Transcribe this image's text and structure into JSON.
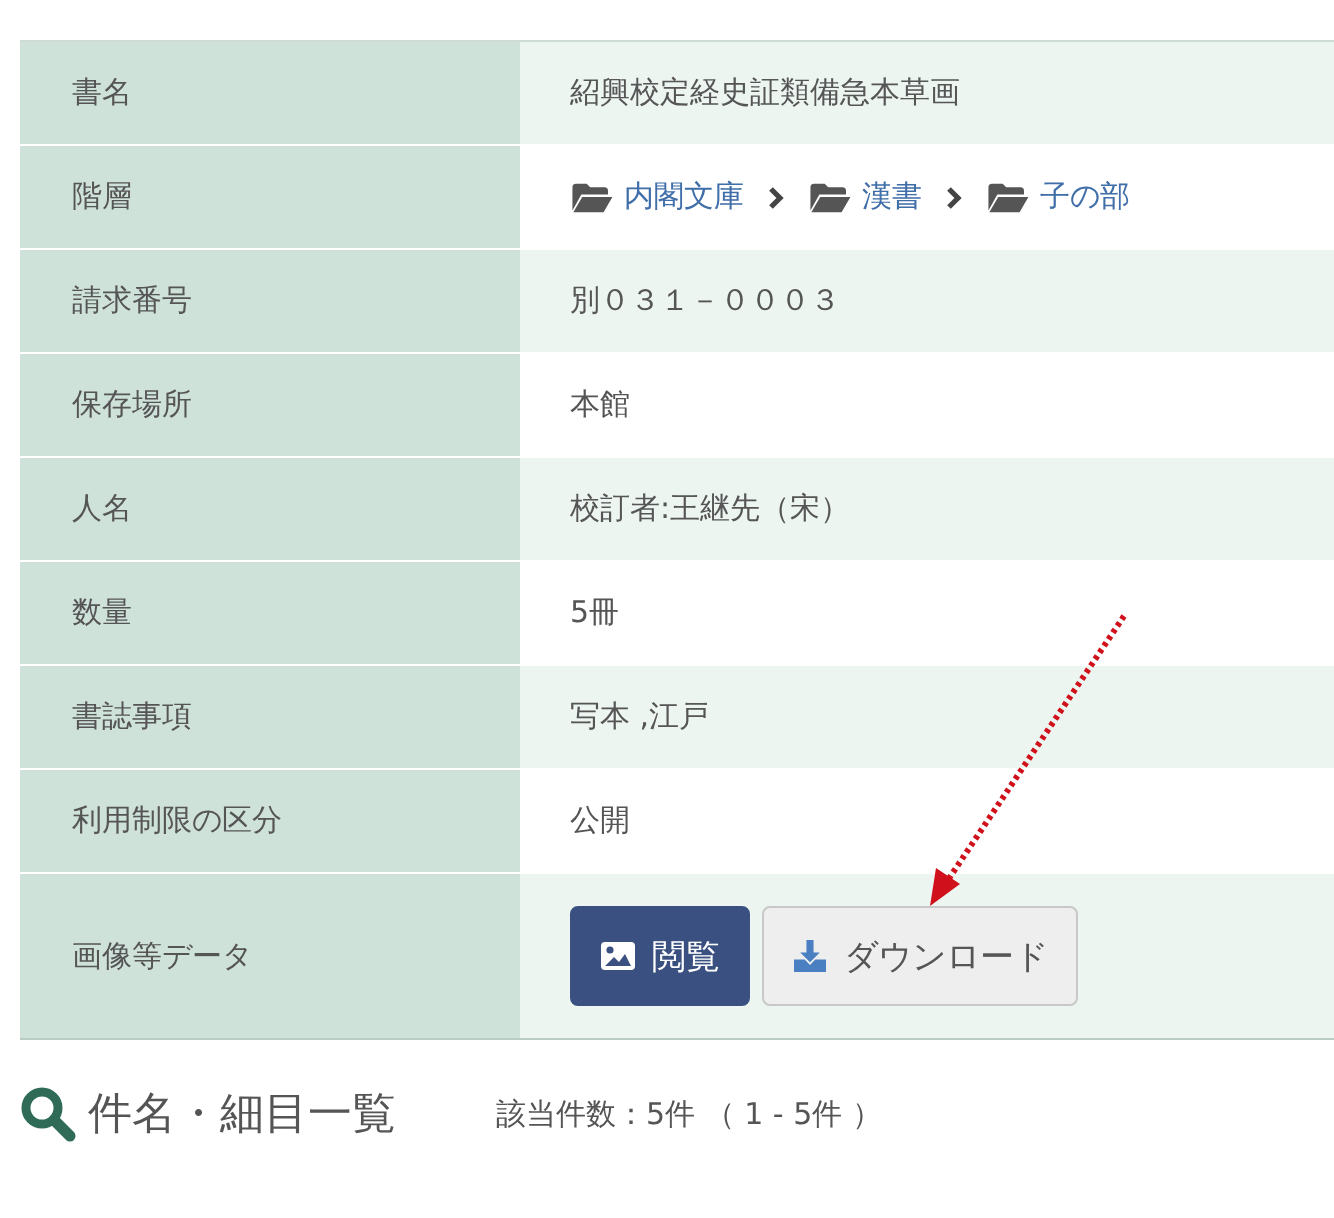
{
  "rows": [
    {
      "label": "書名",
      "kind": "text",
      "value": "紹興校定経史証類備急本草画"
    },
    {
      "label": "階層",
      "kind": "breadcrumb",
      "items": [
        "内閣文庫",
        "漢書",
        "子の部"
      ]
    },
    {
      "label": "請求番号",
      "kind": "text",
      "value": "別０３１－０００３"
    },
    {
      "label": "保存場所",
      "kind": "text",
      "value": "本館"
    },
    {
      "label": "人名",
      "kind": "text",
      "value": "校訂者:王継先（宋）"
    },
    {
      "label": "数量",
      "kind": "text",
      "value": "5冊"
    },
    {
      "label": "書誌事項",
      "kind": "text",
      "value": "写本 ,江戸"
    },
    {
      "label": "利用制限の区分",
      "kind": "text",
      "value": "公開"
    },
    {
      "label": "画像等データ",
      "kind": "buttons",
      "buttons": [
        "閲覧",
        "ダウンロード"
      ]
    }
  ],
  "list_heading": {
    "title": "件名・細目一覧",
    "count": "該当件数：5件 （ 1 - 5件 ）"
  }
}
